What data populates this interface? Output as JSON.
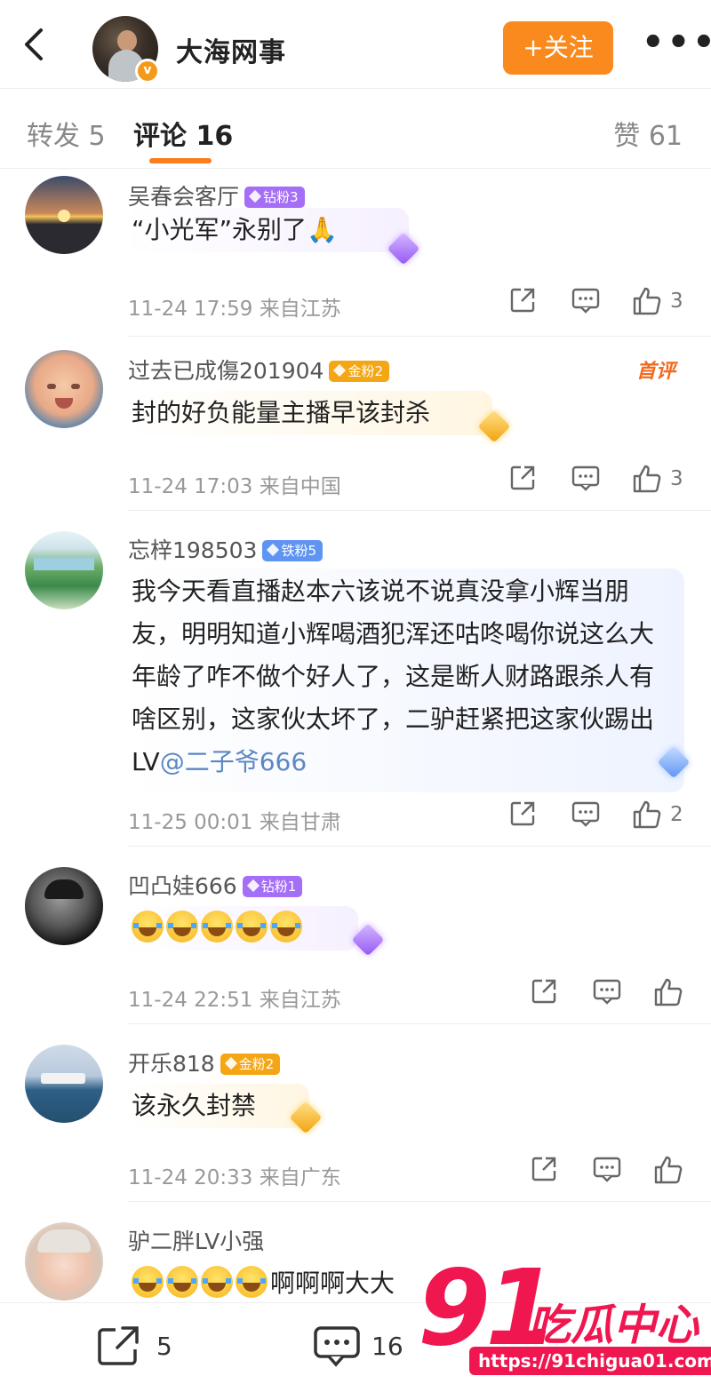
{
  "header": {
    "title": "大海网事",
    "follow_label": "+关注",
    "verified_mark": "v",
    "more_label": "•••"
  },
  "tabs": {
    "forward": "转发 5",
    "comments": "评论 16",
    "likes": "赞 61"
  },
  "colors": {
    "accent": "#fa8a1e",
    "mention": "#5b87c4",
    "fan_purple": "#a56ef7",
    "fan_gold": "#f4a614",
    "fan_blue": "#5f94f2",
    "watermark": "#f0164f"
  },
  "comments": [
    {
      "name": "吴春会客厅",
      "badge": "钻粉3",
      "text": "“小光军”永别了🙏",
      "time_location": "11-24 17:59 来自江苏",
      "likes": "3"
    },
    {
      "name": "过去已成傷201904",
      "badge": "金粉2",
      "tag": "首评",
      "text": "封的好负能量主播早该封杀",
      "time_location": "11-24 17:03 来自中国",
      "likes": "3"
    },
    {
      "name": "忘梓198503",
      "badge": "铁粉5",
      "text": "我今天看直播赵本六该说不说真没拿小辉当朋友，明明知道小辉喝酒犯浑还咕咚喝你说这么大年龄了咋不做个好人了，这是断人财路跟杀人有啥区别，这家伙太坏了，二驴赶紧把这家伙踢出LV",
      "mention": "@二子爷666",
      "time_location": "11-25 00:01 来自甘肃",
      "likes": "2"
    },
    {
      "name": "凹凸娃666",
      "badge": "钻粉1",
      "text": "",
      "time_location": "11-24 22:51 来自江苏",
      "likes": ""
    },
    {
      "name": "开乐818",
      "badge": "金粉2",
      "text": "该永久封禁",
      "time_location": "11-24 20:33 来自广东",
      "likes": ""
    },
    {
      "name": "驴二胖LV小强",
      "text": "啊啊啊大大"
    }
  ],
  "bottom_bar": {
    "forward_count": "5",
    "comment_count": "16"
  },
  "watermark": {
    "number": "91",
    "text": "吃瓜中心",
    "url": "https://91chigua01.com"
  },
  "icons": [
    "back-arrow-icon",
    "verified-icon",
    "more-icon",
    "share-icon",
    "comment-icon",
    "like-icon",
    "fan-gem-icon"
  ]
}
